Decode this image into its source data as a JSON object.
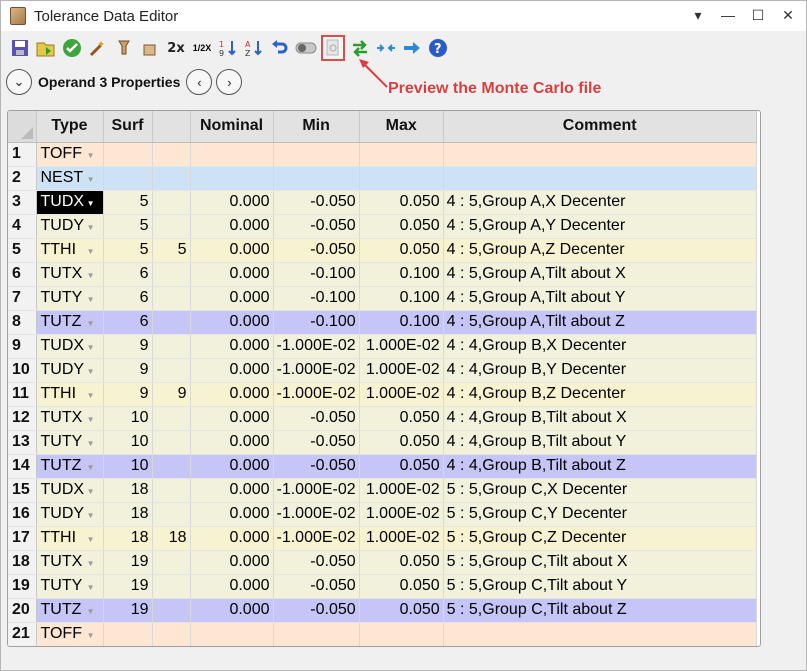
{
  "window": {
    "title": "Tolerance Data Editor",
    "controls": {
      "menu": "▾",
      "minimize": "—",
      "maximize": "☐",
      "close": "✕"
    }
  },
  "toolbar": {
    "zoom_2x": "2x",
    "half_2x": "1/2X"
  },
  "operand_bar": {
    "label": "Operand  3 Properties"
  },
  "annotation": {
    "text": "Preview the Monte Carlo file"
  },
  "table": {
    "headers": [
      "Type",
      "Surf",
      "",
      "Nominal",
      "Min",
      "Max",
      "Comment"
    ],
    "rows": [
      {
        "n": "1",
        "type": "TOFF",
        "surf": "",
        "p2": "",
        "nominal": "",
        "min": "",
        "max": "",
        "comment": "",
        "color": "#fde6d2"
      },
      {
        "n": "2",
        "type": "NEST",
        "surf": "",
        "p2": "",
        "nominal": "",
        "min": "",
        "max": "",
        "comment": "",
        "color": "#cde2f4"
      },
      {
        "n": "3",
        "type": "TUDX",
        "surf": "5",
        "p2": "",
        "nominal": "0.000",
        "min": "-0.050",
        "max": "0.050",
        "comment": "4 : 5,Group A,X Decenter",
        "color": "#f1f1dc",
        "selected": true
      },
      {
        "n": "4",
        "type": "TUDY",
        "surf": "5",
        "p2": "",
        "nominal": "0.000",
        "min": "-0.050",
        "max": "0.050",
        "comment": "4 : 5,Group A,Y Decenter",
        "color": "#f1f1dc"
      },
      {
        "n": "5",
        "type": "TTHI",
        "surf": "5",
        "p2": "5",
        "nominal": "0.000",
        "min": "-0.050",
        "max": "0.050",
        "comment": "4 : 5,Group A,Z Decenter",
        "color": "#f7f2cf"
      },
      {
        "n": "6",
        "type": "TUTX",
        "surf": "6",
        "p2": "",
        "nominal": "0.000",
        "min": "-0.100",
        "max": "0.100",
        "comment": "4 : 5,Group A,Tilt about X",
        "color": "#f1f1dc"
      },
      {
        "n": "7",
        "type": "TUTY",
        "surf": "6",
        "p2": "",
        "nominal": "0.000",
        "min": "-0.100",
        "max": "0.100",
        "comment": "4 : 5,Group A,Tilt about Y",
        "color": "#f1f1dc"
      },
      {
        "n": "8",
        "type": "TUTZ",
        "surf": "6",
        "p2": "",
        "nominal": "0.000",
        "min": "-0.100",
        "max": "0.100",
        "comment": "4 : 5,Group A,Tilt about Z",
        "color": "#c5c5f7"
      },
      {
        "n": "9",
        "type": "TUDX",
        "surf": "9",
        "p2": "",
        "nominal": "0.000",
        "min": "-1.000E-02",
        "max": "1.000E-02",
        "comment": "4 : 4,Group B,X Decenter",
        "color": "#f1f1dc"
      },
      {
        "n": "10",
        "type": "TUDY",
        "surf": "9",
        "p2": "",
        "nominal": "0.000",
        "min": "-1.000E-02",
        "max": "1.000E-02",
        "comment": "4 : 4,Group B,Y Decenter",
        "color": "#f1f1dc"
      },
      {
        "n": "11",
        "type": "TTHI",
        "surf": "9",
        "p2": "9",
        "nominal": "0.000",
        "min": "-1.000E-02",
        "max": "1.000E-02",
        "comment": "4 : 4,Group B,Z Decenter",
        "color": "#f7f2cf"
      },
      {
        "n": "12",
        "type": "TUTX",
        "surf": "10",
        "p2": "",
        "nominal": "0.000",
        "min": "-0.050",
        "max": "0.050",
        "comment": "4 : 4,Group B,Tilt about X",
        "color": "#f1f1dc"
      },
      {
        "n": "13",
        "type": "TUTY",
        "surf": "10",
        "p2": "",
        "nominal": "0.000",
        "min": "-0.050",
        "max": "0.050",
        "comment": "4 : 4,Group B,Tilt about Y",
        "color": "#f1f1dc"
      },
      {
        "n": "14",
        "type": "TUTZ",
        "surf": "10",
        "p2": "",
        "nominal": "0.000",
        "min": "-0.050",
        "max": "0.050",
        "comment": "4 : 4,Group B,Tilt about Z",
        "color": "#c5c5f7"
      },
      {
        "n": "15",
        "type": "TUDX",
        "surf": "18",
        "p2": "",
        "nominal": "0.000",
        "min": "-1.000E-02",
        "max": "1.000E-02",
        "comment": "5 : 5,Group C,X Decenter",
        "color": "#f1f1dc"
      },
      {
        "n": "16",
        "type": "TUDY",
        "surf": "18",
        "p2": "",
        "nominal": "0.000",
        "min": "-1.000E-02",
        "max": "1.000E-02",
        "comment": "5 : 5,Group C,Y Decenter",
        "color": "#f1f1dc"
      },
      {
        "n": "17",
        "type": "TTHI",
        "surf": "18",
        "p2": "18",
        "nominal": "0.000",
        "min": "-1.000E-02",
        "max": "1.000E-02",
        "comment": "5 : 5,Group C,Z Decenter",
        "color": "#f7f2cf"
      },
      {
        "n": "18",
        "type": "TUTX",
        "surf": "19",
        "p2": "",
        "nominal": "0.000",
        "min": "-0.050",
        "max": "0.050",
        "comment": "5 : 5,Group C,Tilt about X",
        "color": "#f1f1dc"
      },
      {
        "n": "19",
        "type": "TUTY",
        "surf": "19",
        "p2": "",
        "nominal": "0.000",
        "min": "-0.050",
        "max": "0.050",
        "comment": "5 : 5,Group C,Tilt about Y",
        "color": "#f1f1dc"
      },
      {
        "n": "20",
        "type": "TUTZ",
        "surf": "19",
        "p2": "",
        "nominal": "0.000",
        "min": "-0.050",
        "max": "0.050",
        "comment": "5 : 5,Group C,Tilt about Z",
        "color": "#c5c5f7"
      },
      {
        "n": "21",
        "type": "TOFF",
        "surf": "",
        "p2": "",
        "nominal": "",
        "min": "",
        "max": "",
        "comment": "",
        "color": "#fde6d2"
      }
    ]
  }
}
